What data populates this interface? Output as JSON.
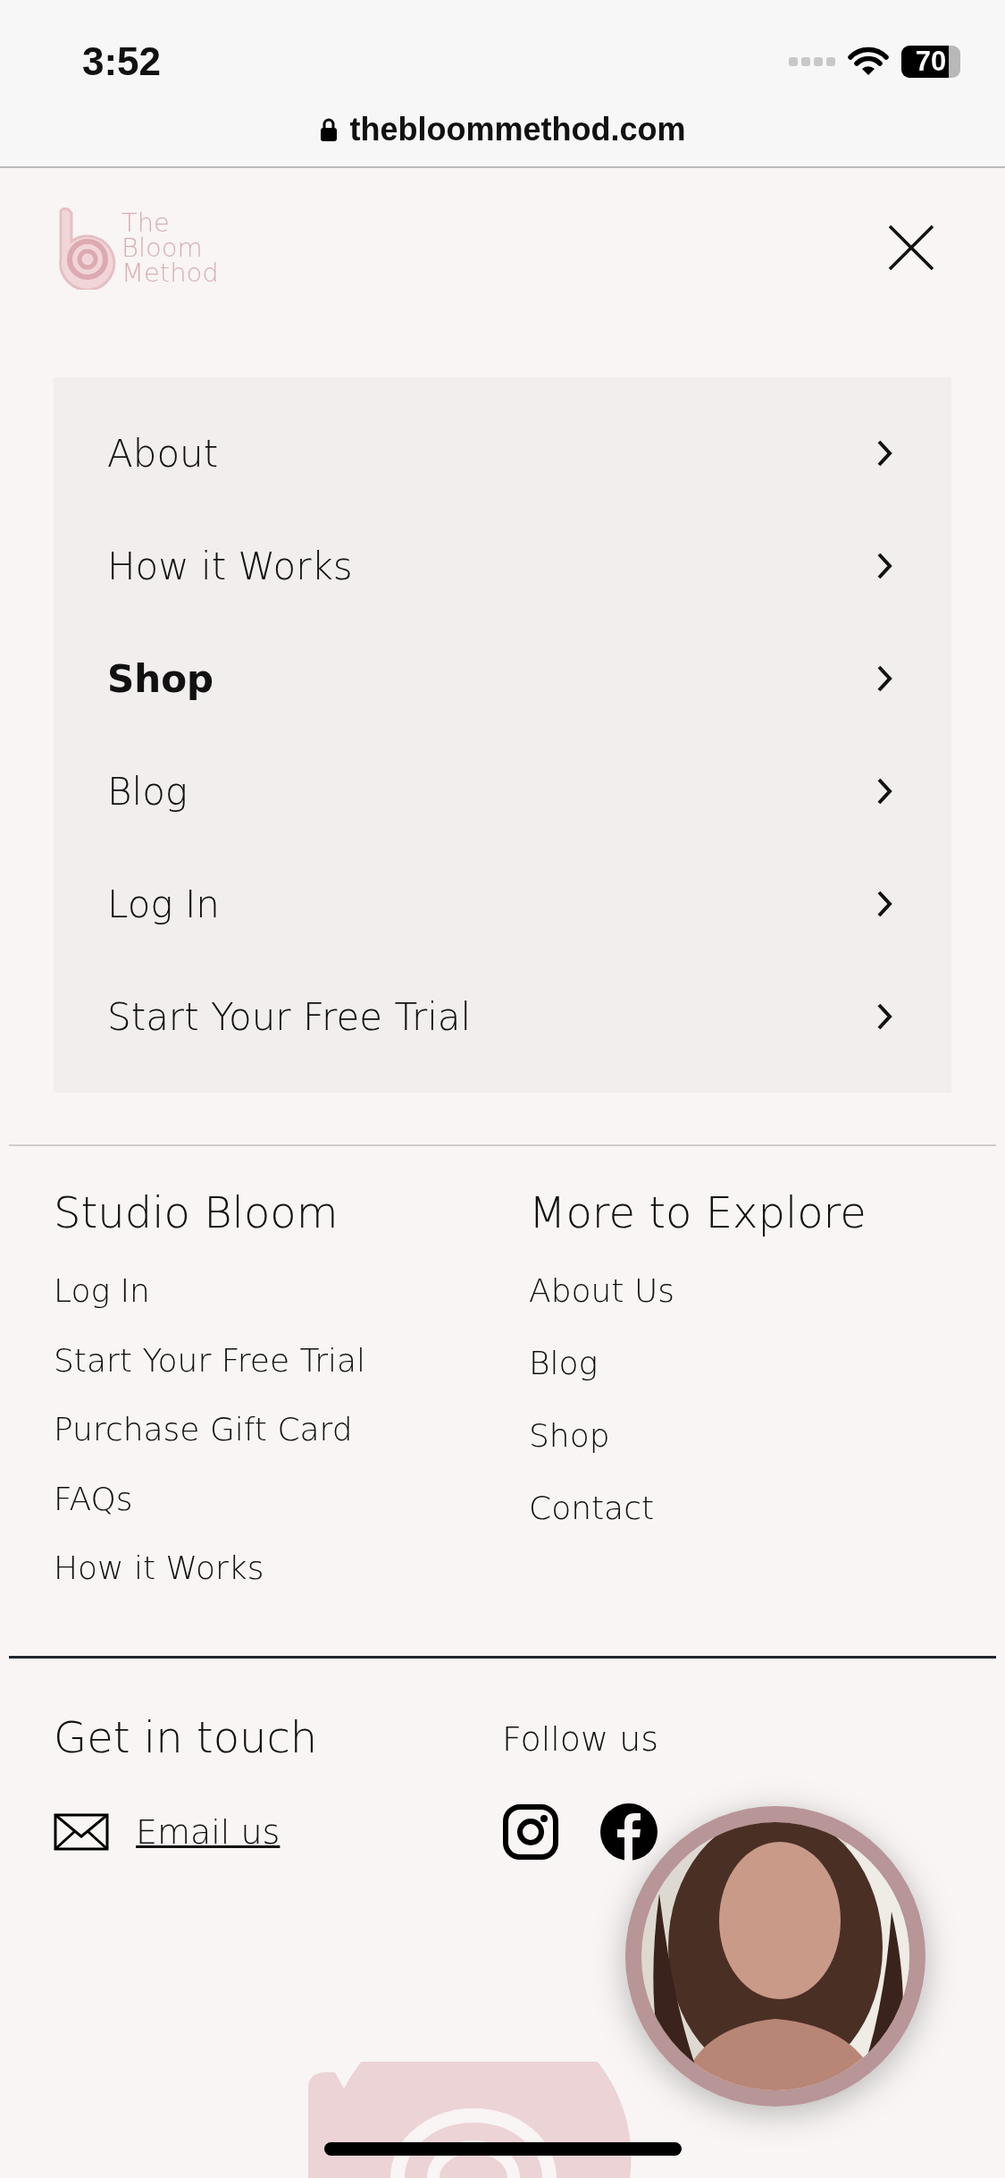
{
  "status_bar": {
    "time": "3:52",
    "battery": "70"
  },
  "browser": {
    "url": "thebloommethod.com"
  },
  "logo": {
    "lines": [
      "The",
      "Bloom",
      "Method"
    ]
  },
  "menu": [
    {
      "label": "About",
      "selected": false
    },
    {
      "label": "How it Works",
      "selected": false
    },
    {
      "label": "Shop",
      "selected": true
    },
    {
      "label": "Blog",
      "selected": false
    },
    {
      "label": "Log In",
      "selected": false
    },
    {
      "label": "Start Your Free Trial",
      "selected": false
    }
  ],
  "footer_columns": [
    {
      "title": "Studio Bloom",
      "links": [
        "Log In",
        "Start Your Free Trial",
        "Purchase Gift Card",
        "FAQs",
        "How it Works"
      ]
    },
    {
      "title": "More to Explore",
      "links": [
        "About Us",
        "Blog",
        "Shop",
        "Contact"
      ]
    }
  ],
  "contact": {
    "title": "Get in touch",
    "email_link": "Email us"
  },
  "social": {
    "title": "Follow us"
  }
}
